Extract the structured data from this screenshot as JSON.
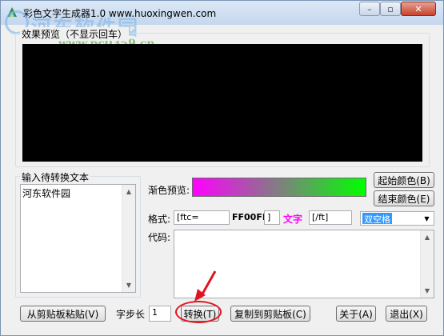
{
  "window": {
    "title": "彩色文字生成器1.0  www.huoxingwen.com",
    "minimize_glyph": "–",
    "maximize_glyph": "▫",
    "close_glyph": "✕"
  },
  "watermark": {
    "name": "河东软件园",
    "url": "www.pc0359.cn"
  },
  "preview_group": {
    "label": "效果预览（不显示回车）"
  },
  "input_group": {
    "label": "输入待转换文本",
    "text": "河东软件园"
  },
  "gradient": {
    "label": "渐色预览:",
    "start_color": "#ff00ff",
    "end_color": "#00ff00",
    "start_button": "起始颜色(B)",
    "end_button": "结束颜色(E)"
  },
  "format": {
    "label": "格式:",
    "open_tag": "[ftc=",
    "color_value": "FF00FF",
    "bracket": "]",
    "sample_text": "文字",
    "sample_color": "#ff00ff",
    "close_tag": "[/ft]",
    "space_option": "双空格"
  },
  "code": {
    "label": "代码:"
  },
  "bottom": {
    "paste_button": "从剪贴板粘贴(V)",
    "step_label": "字步长",
    "step_value": "1",
    "convert_button": "转换(T)",
    "copy_button": "复制到剪贴板(C)",
    "about_button": "关于(A)",
    "exit_button": "退出(X)"
  }
}
